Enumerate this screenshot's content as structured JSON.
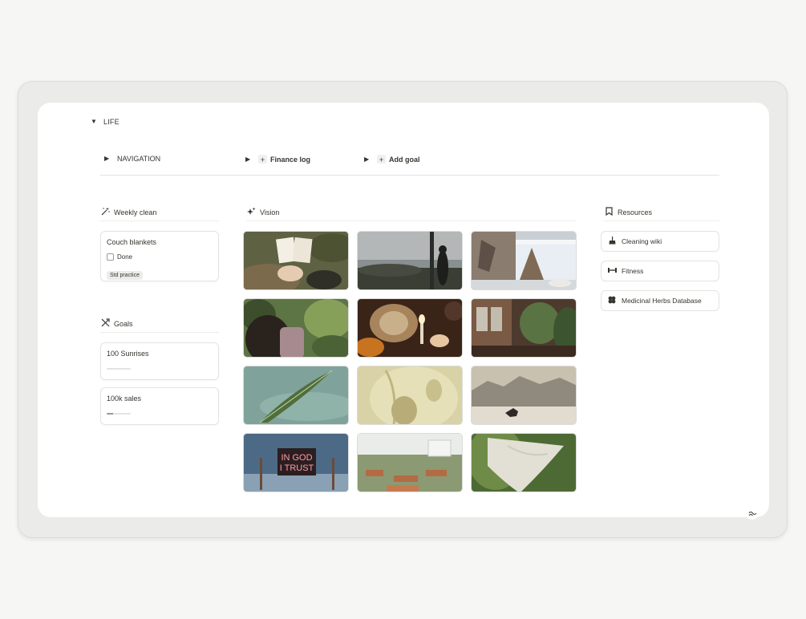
{
  "life": {
    "label": "LIFE"
  },
  "nav": {
    "navigation": "NAVIGATION",
    "finance_log": "Finance log",
    "add_goal": "Add goal"
  },
  "weekly": {
    "title": "Weekly clean",
    "card": {
      "title": "Couch blankets",
      "checkbox_label": "Done",
      "checked": false,
      "tag": "Std practice"
    }
  },
  "goals": {
    "title": "Goals",
    "items": [
      {
        "title": "100 Sunrises",
        "progress": 0.0
      },
      {
        "title": "100k sales",
        "progress": 0.25
      }
    ]
  },
  "vision": {
    "title": "Vision",
    "tiles": [
      {
        "name": "reading-book-photo",
        "overlay_text": ""
      },
      {
        "name": "cloudy-silhouette-photo",
        "overlay_text": ""
      },
      {
        "name": "window-view-photo",
        "overlay_text": ""
      },
      {
        "name": "garden-woman-photo",
        "overlay_text": ""
      },
      {
        "name": "candle-ritual-photo",
        "overlay_text": ""
      },
      {
        "name": "plant-doorway-photo",
        "overlay_text": ""
      },
      {
        "name": "leaf-water-photo",
        "overlay_text": ""
      },
      {
        "name": "leaf-shadow-photo",
        "overlay_text": ""
      },
      {
        "name": "horse-desert-photo",
        "overlay_text": ""
      },
      {
        "name": "neon-sign-photo",
        "overlay_text": "IN GOD I TRUST"
      },
      {
        "name": "greenhouse-garden-photo",
        "overlay_text": ""
      },
      {
        "name": "flowing-dress-photo",
        "overlay_text": ""
      }
    ]
  },
  "resources": {
    "title": "Resources",
    "items": [
      {
        "label": "Cleaning wiki",
        "icon": "broom-icon"
      },
      {
        "label": "Fitness",
        "icon": "dumbbell-icon"
      },
      {
        "label": "Medicinal Herbs Database",
        "icon": "herb-icon"
      }
    ]
  },
  "colors": {
    "text": "#37352f",
    "border": "#e3e3e1",
    "frame_bg": "#ebebea",
    "page_bg": "#ffffff"
  }
}
